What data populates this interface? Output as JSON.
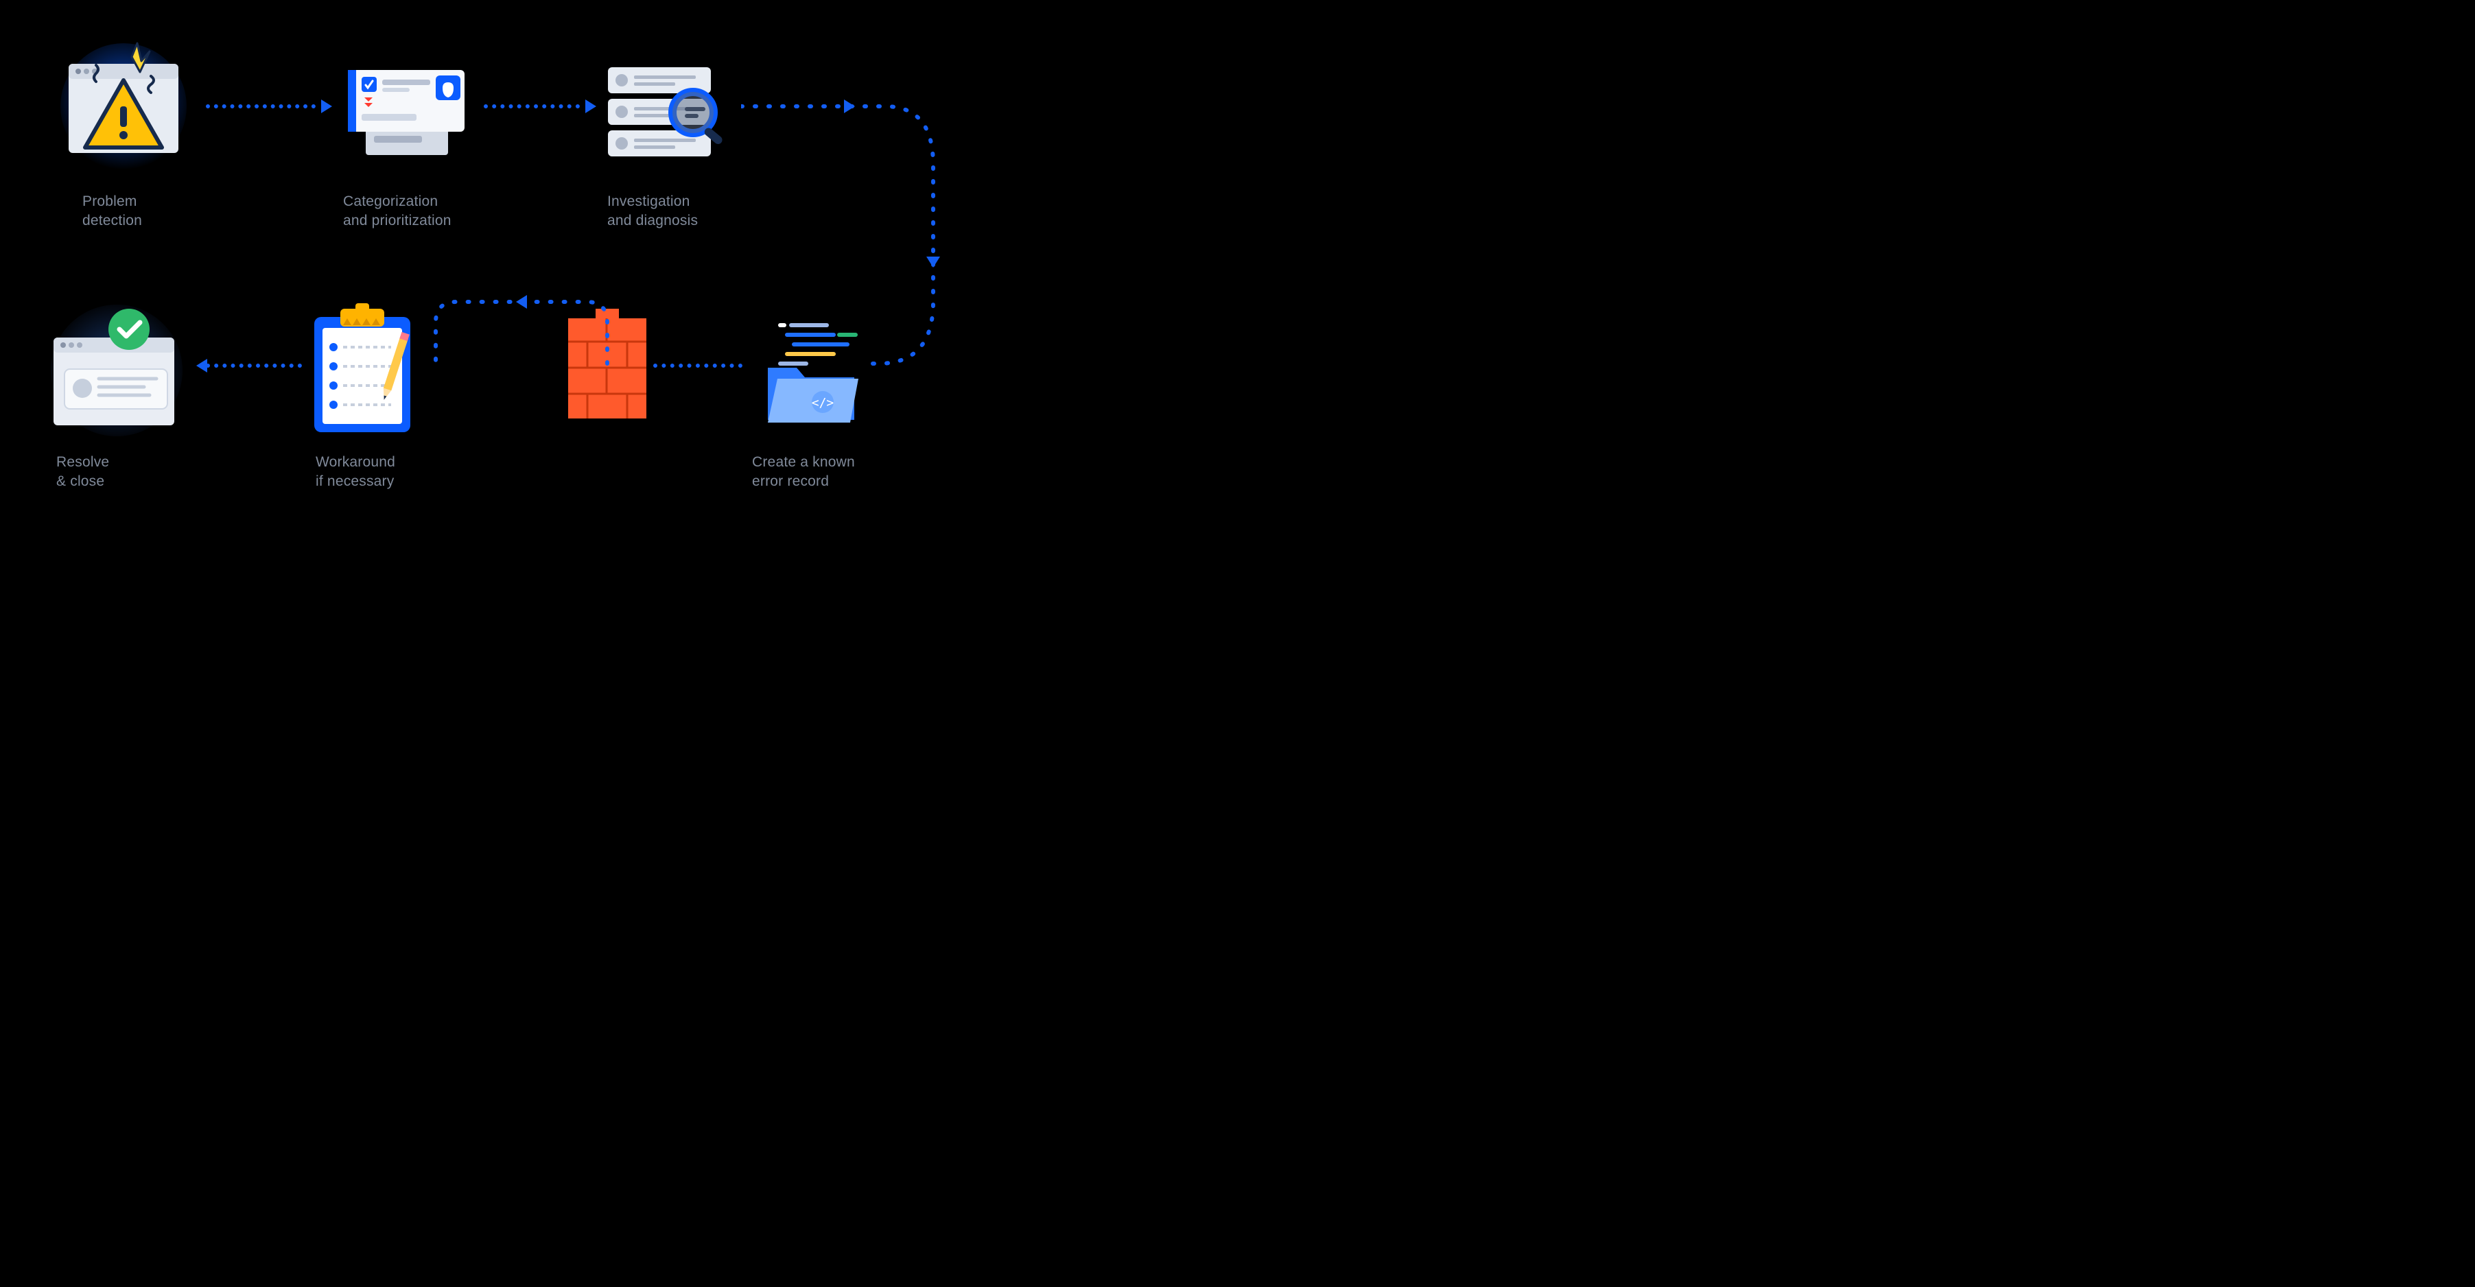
{
  "steps": {
    "detection": {
      "line1": "Problem",
      "line2": "detection"
    },
    "categorization": {
      "line1": "Categorization",
      "line2": "and prioritization"
    },
    "investigation": {
      "line1": "Investigation",
      "line2": "and diagnosis"
    },
    "error_record": {
      "line1": "Create a known",
      "line2": "error record"
    },
    "workaround": {
      "line1": "Workaround",
      "line2": "if necessary"
    },
    "resolve": {
      "line1": "Resolve",
      "line2": "& close"
    }
  }
}
